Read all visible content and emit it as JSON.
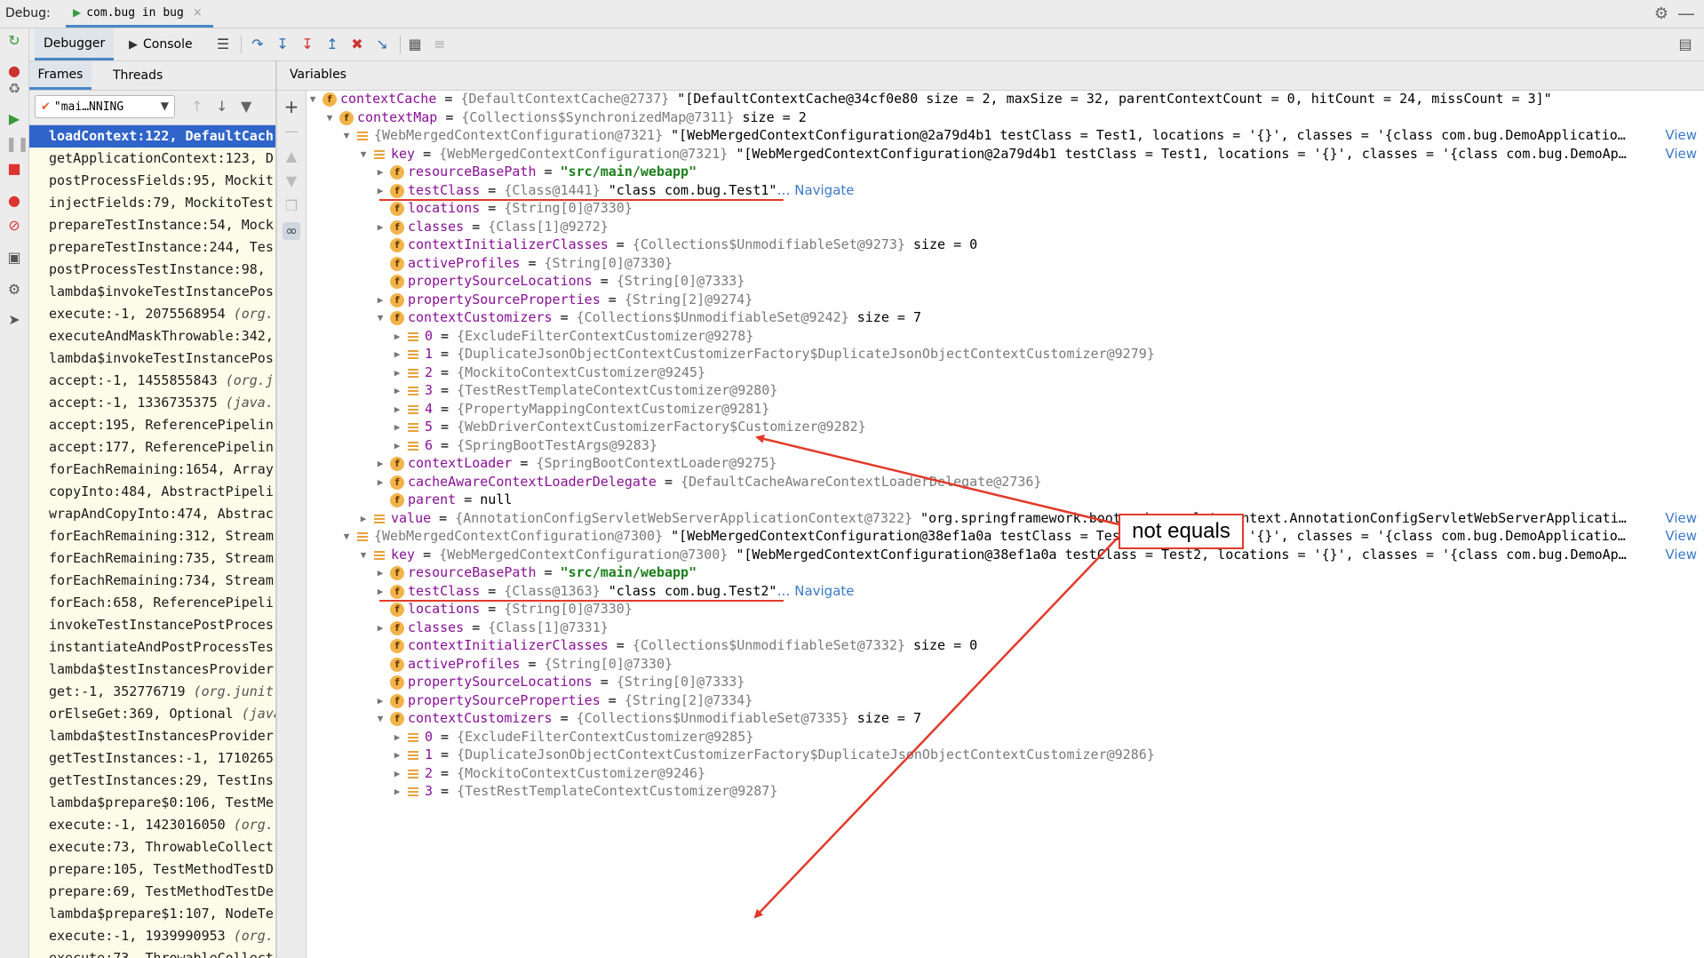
{
  "debug_bar": {
    "label": "Debug:",
    "tab_label": "com.bug in bug",
    "tab_close": "×"
  },
  "toolbar": {
    "debugger_tab": "Debugger",
    "console_tab": "Console"
  },
  "frames_panel": {
    "tabs": [
      "Frames",
      "Threads"
    ],
    "thread_selector": "\"mai…NNING",
    "frames": [
      {
        "text": "loadContext:122, DefaultCach",
        "selected": true
      },
      {
        "text": "getApplicationContext:123, D"
      },
      {
        "text": "postProcessFields:95, Mockit"
      },
      {
        "text": "injectFields:79, MockitoTest"
      },
      {
        "text": "prepareTestInstance:54, Mock"
      },
      {
        "text": "prepareTestInstance:244, Tes"
      },
      {
        "text": "postProcessTestInstance:98, "
      },
      {
        "text": "lambda$invokeTestInstancePos"
      },
      {
        "text": "execute:-1, 2075568954 ",
        "italic": "(org."
      },
      {
        "text": "executeAndMaskThrowable:342,"
      },
      {
        "text": "lambda$invokeTestInstancePos"
      },
      {
        "text": "accept:-1, 1455855843 ",
        "italic": "(org.j"
      },
      {
        "text": "accept:-1, 1336735375 ",
        "italic": "(java."
      },
      {
        "text": "accept:195, ReferencePipelin"
      },
      {
        "text": "accept:177, ReferencePipelin"
      },
      {
        "text": "forEachRemaining:1654, Array"
      },
      {
        "text": "copyInto:484, AbstractPipeli"
      },
      {
        "text": "wrapAndCopyInto:474, Abstrac"
      },
      {
        "text": "forEachRemaining:312, Stream"
      },
      {
        "text": "forEachRemaining:735, Stream"
      },
      {
        "text": "forEachRemaining:734, Stream"
      },
      {
        "text": "forEach:658, ReferencePipeli"
      },
      {
        "text": "invokeTestInstancePostProces"
      },
      {
        "text": "instantiateAndPostProcessTes"
      },
      {
        "text": "lambda$testInstancesProvider"
      },
      {
        "text": "get:-1, 352776719 ",
        "italic": "(org.junit"
      },
      {
        "text": "orElseGet:369, Optional ",
        "italic": "(java"
      },
      {
        "text": "lambda$testInstancesProvider"
      },
      {
        "text": "getTestInstances:-1, 1710265"
      },
      {
        "text": "getTestInstances:29, TestIns"
      },
      {
        "text": "lambda$prepare$0:106, TestMe"
      },
      {
        "text": "execute:-1, 1423016050 ",
        "italic": "(org."
      },
      {
        "text": "execute:73, ThrowableCollect"
      },
      {
        "text": "prepare:105, TestMethodTestD"
      },
      {
        "text": "prepare:69, TestMethodTestDe"
      },
      {
        "text": "lambda$prepare$1:107, NodeTe"
      },
      {
        "text": "execute:-1, 1939990953 ",
        "italic": "(org."
      },
      {
        "text": "execute:73, ThrowableCollect"
      }
    ]
  },
  "variables": {
    "header": "Variables",
    "view_label": "View",
    "navigate_label": "Navigate",
    "rows": [
      {
        "level": 0,
        "arrow": "down",
        "icon": "field",
        "name": "contextCache",
        "eq": " = ",
        "type": "{DefaultContextCache@2737}",
        "value": " \"[DefaultContextCache@34cf0e80 size = 2, maxSize = 32, parentContextCount = 0, hitCount = 24, missCount = 3]\""
      },
      {
        "level": 1,
        "arrow": "down",
        "icon": "field",
        "name": "contextMap",
        "eq": " = ",
        "type": "{Collections$SynchronizedMap@7311}",
        "value": "  size = 2"
      },
      {
        "level": 2,
        "arrow": "down",
        "icon": "list",
        "name": "",
        "eq": "",
        "type": "{WebMergedContextConfiguration@7321}",
        "value": " \"[WebMergedContextConfiguration@2a79d4b1 testClass = Test1, locations = '{}', classes = '{class com.bug.DemoApplicatio…",
        "view": true
      },
      {
        "level": 3,
        "arrow": "down",
        "icon": "list",
        "name": "key",
        "eq": " = ",
        "type": "{WebMergedContextConfiguration@7321}",
        "value": " \"[WebMergedContextConfiguration@2a79d4b1 testClass = Test1, locations = '{}', classes = '{class com.bug.DemoAp…",
        "view": true
      },
      {
        "level": 4,
        "arrow": "right",
        "icon": "field",
        "name": "resourceBasePath",
        "eq": " = ",
        "str": "\"src/main/webapp\""
      },
      {
        "level": 4,
        "arrow": "right",
        "icon": "field",
        "name": "testClass",
        "eq": " = ",
        "type": "{Class@1441}",
        "value": " \"class com.bug.Test1\"",
        "navigate": true,
        "underline": true
      },
      {
        "level": 4,
        "arrow": "",
        "icon": "field",
        "name": "locations",
        "eq": " = ",
        "type": "{String[0]@7330}"
      },
      {
        "level": 4,
        "arrow": "right",
        "icon": "field",
        "name": "classes",
        "eq": " = ",
        "type": "{Class[1]@9272}"
      },
      {
        "level": 4,
        "arrow": "",
        "icon": "field",
        "name": "contextInitializerClasses",
        "eq": " = ",
        "type": "{Collections$UnmodifiableSet@9273}",
        "value": "  size = 0"
      },
      {
        "level": 4,
        "arrow": "",
        "icon": "field",
        "name": "activeProfiles",
        "eq": " = ",
        "type": "{String[0]@7330}"
      },
      {
        "level": 4,
        "arrow": "",
        "icon": "field",
        "name": "propertySourceLocations",
        "eq": " = ",
        "type": "{String[0]@7333}"
      },
      {
        "level": 4,
        "arrow": "right",
        "icon": "field",
        "name": "propertySourceProperties",
        "eq": " = ",
        "type": "{String[2]@9274}"
      },
      {
        "level": 4,
        "arrow": "down",
        "icon": "field",
        "name": "contextCustomizers",
        "eq": " = ",
        "type": "{Collections$UnmodifiableSet@9242}",
        "value": "  size = 7"
      },
      {
        "level": 5,
        "arrow": "right",
        "icon": "list",
        "name": "0",
        "eq": " = ",
        "type": "{ExcludeFilterContextCustomizer@9278}"
      },
      {
        "level": 5,
        "arrow": "right",
        "icon": "list",
        "name": "1",
        "eq": " = ",
        "type": "{DuplicateJsonObjectContextCustomizerFactory$DuplicateJsonObjectContextCustomizer@9279}"
      },
      {
        "level": 5,
        "arrow": "right",
        "icon": "list",
        "name": "2",
        "eq": " = ",
        "type": "{MockitoContextCustomizer@9245}"
      },
      {
        "level": 5,
        "arrow": "right",
        "icon": "list",
        "name": "3",
        "eq": " = ",
        "type": "{TestRestTemplateContextCustomizer@9280}"
      },
      {
        "level": 5,
        "arrow": "right",
        "icon": "list",
        "name": "4",
        "eq": " = ",
        "type": "{PropertyMappingContextCustomizer@9281}"
      },
      {
        "level": 5,
        "arrow": "right",
        "icon": "list",
        "name": "5",
        "eq": " = ",
        "type": "{WebDriverContextCustomizerFactory$Customizer@9282}"
      },
      {
        "level": 5,
        "arrow": "right",
        "icon": "list",
        "name": "6",
        "eq": " = ",
        "type": "{SpringBootTestArgs@9283}"
      },
      {
        "level": 4,
        "arrow": "right",
        "icon": "field",
        "name": "contextLoader",
        "eq": " = ",
        "type": "{SpringBootContextLoader@9275}"
      },
      {
        "level": 4,
        "arrow": "right",
        "icon": "field",
        "name": "cacheAwareContextLoaderDelegate",
        "eq": " = ",
        "type": "{DefaultCacheAwareContextLoaderDelegate@2736}"
      },
      {
        "level": 4,
        "arrow": "",
        "icon": "field",
        "name": "parent",
        "eq": " = ",
        "plain": "null"
      },
      {
        "level": 3,
        "arrow": "right",
        "icon": "list",
        "name": "value",
        "eq": " = ",
        "type": "{AnnotationConfigServletWebServerApplicationContext@7322}",
        "value": " \"org.springframework.boot.web.servlet.context.AnnotationConfigServletWebServerApplicati…",
        "view": true
      },
      {
        "level": 2,
        "arrow": "down",
        "icon": "list",
        "name": "",
        "eq": "",
        "type": "{WebMergedContextConfiguration@7300}",
        "value": " \"[WebMergedContextConfiguration@38ef1a0a testClass = Test2, locations = '{}', classes = '{class com.bug.DemoApplicatio…",
        "view": true
      },
      {
        "level": 3,
        "arrow": "down",
        "icon": "list",
        "name": "key",
        "eq": " = ",
        "type": "{WebMergedContextConfiguration@7300}",
        "value": " \"[WebMergedContextConfiguration@38ef1a0a testClass = Test2, locations = '{}', classes = '{class com.bug.DemoAp…",
        "view": true
      },
      {
        "level": 4,
        "arrow": "right",
        "icon": "field",
        "name": "resourceBasePath",
        "eq": " = ",
        "str": "\"src/main/webapp\""
      },
      {
        "level": 4,
        "arrow": "right",
        "icon": "field",
        "name": "testClass",
        "eq": " = ",
        "type": "{Class@1363}",
        "value": " \"class com.bug.Test2\"",
        "navigate": true,
        "underline": true
      },
      {
        "level": 4,
        "arrow": "",
        "icon": "field",
        "name": "locations",
        "eq": " = ",
        "type": "{String[0]@7330}"
      },
      {
        "level": 4,
        "arrow": "right",
        "icon": "field",
        "name": "classes",
        "eq": " = ",
        "type": "{Class[1]@7331}"
      },
      {
        "level": 4,
        "arrow": "",
        "icon": "field",
        "name": "contextInitializerClasses",
        "eq": " = ",
        "type": "{Collections$UnmodifiableSet@7332}",
        "value": "  size = 0"
      },
      {
        "level": 4,
        "arrow": "",
        "icon": "field",
        "name": "activeProfiles",
        "eq": " = ",
        "type": "{String[0]@7330}"
      },
      {
        "level": 4,
        "arrow": "",
        "icon": "field",
        "name": "propertySourceLocations",
        "eq": " = ",
        "type": "{String[0]@7333}"
      },
      {
        "level": 4,
        "arrow": "right",
        "icon": "field",
        "name": "propertySourceProperties",
        "eq": " = ",
        "type": "{String[2]@7334}"
      },
      {
        "level": 4,
        "arrow": "down",
        "icon": "field",
        "name": "contextCustomizers",
        "eq": " = ",
        "type": "{Collections$UnmodifiableSet@7335}",
        "value": "  size = 7"
      },
      {
        "level": 5,
        "arrow": "right",
        "icon": "list",
        "name": "0",
        "eq": " = ",
        "type": "{ExcludeFilterContextCustomizer@9285}"
      },
      {
        "level": 5,
        "arrow": "right",
        "icon": "list",
        "name": "1",
        "eq": " = ",
        "type": "{DuplicateJsonObjectContextCustomizerFactory$DuplicateJsonObjectContextCustomizer@9286}"
      },
      {
        "level": 5,
        "arrow": "right",
        "icon": "list",
        "name": "2",
        "eq": " = ",
        "type": "{MockitoContextCustomizer@9246}"
      },
      {
        "level": 5,
        "arrow": "right",
        "icon": "list",
        "name": "3",
        "eq": " = ",
        "type": "{TestRestTemplateContextCustomizer@9287}"
      }
    ]
  },
  "annotation": {
    "text": "not equals",
    "color": "#e23a2a"
  },
  "colors": {
    "selection": "#2f65ca",
    "frames_bg": "#fcfce8",
    "field_icon": "#f2b34a",
    "link": "#3b78c4",
    "field_name": "#871094",
    "string": "#1b7f1b"
  }
}
